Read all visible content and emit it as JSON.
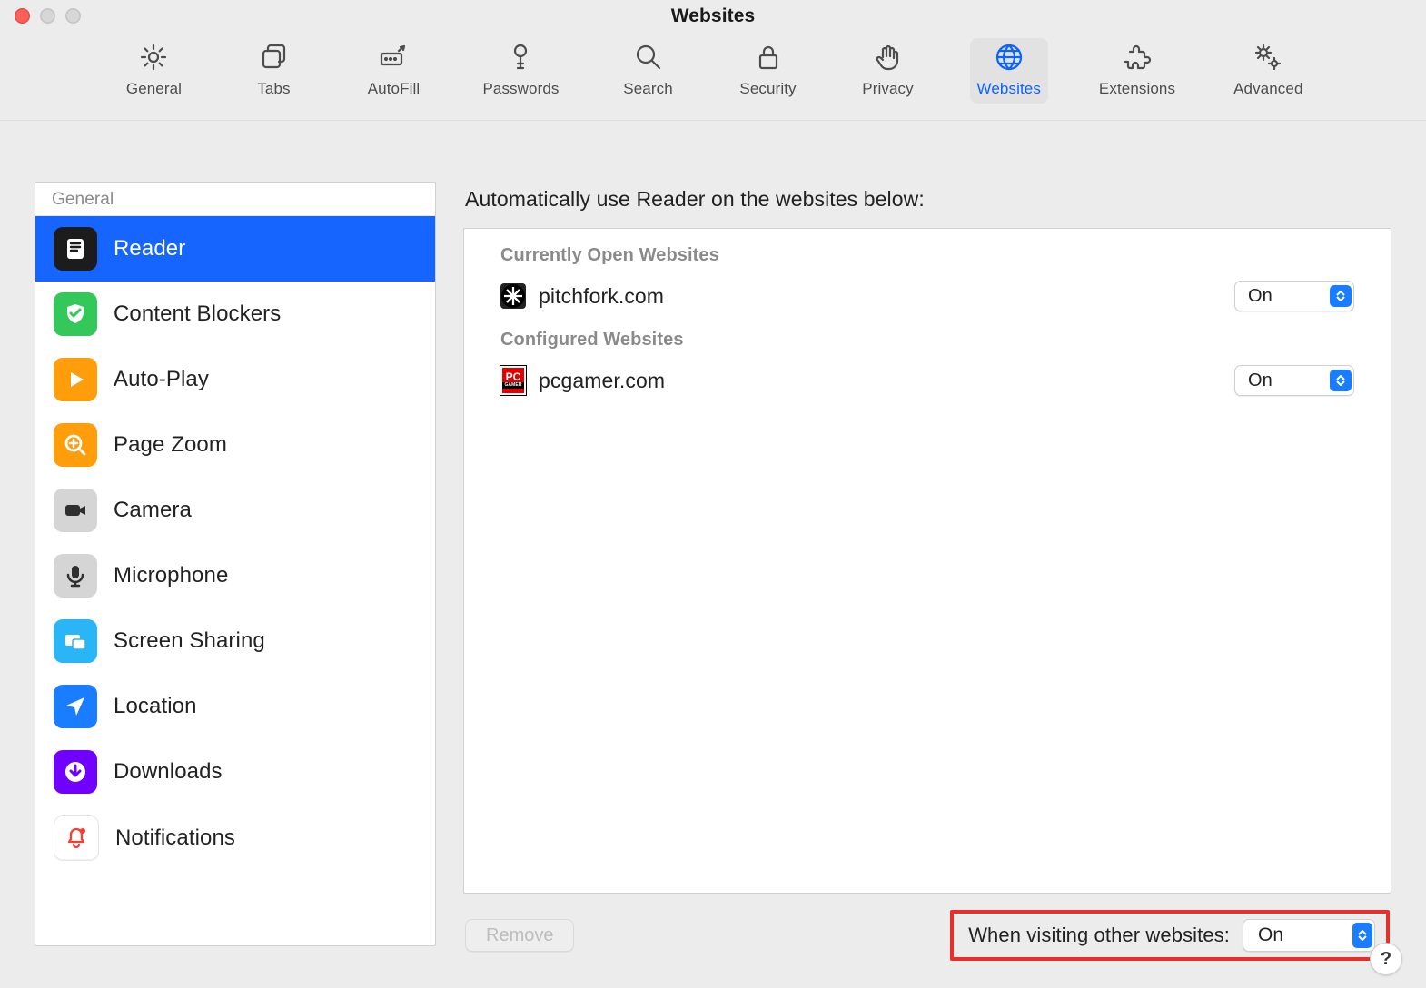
{
  "window": {
    "title": "Websites"
  },
  "traffic": {
    "close": "close",
    "min": "minimize",
    "max": "zoom"
  },
  "toolbar": {
    "items": [
      {
        "id": "general",
        "label": "General",
        "icon": "gear-icon"
      },
      {
        "id": "tabs",
        "label": "Tabs",
        "icon": "tabs-icon"
      },
      {
        "id": "autofill",
        "label": "AutoFill",
        "icon": "autofill-icon"
      },
      {
        "id": "passwords",
        "label": "Passwords",
        "icon": "key-icon"
      },
      {
        "id": "search",
        "label": "Search",
        "icon": "magnify-icon"
      },
      {
        "id": "security",
        "label": "Security",
        "icon": "lock-icon"
      },
      {
        "id": "privacy",
        "label": "Privacy",
        "icon": "hand-icon"
      },
      {
        "id": "websites",
        "label": "Websites",
        "icon": "globe-icon"
      },
      {
        "id": "extensions",
        "label": "Extensions",
        "icon": "puzzle-icon"
      },
      {
        "id": "advanced",
        "label": "Advanced",
        "icon": "gears-icon"
      }
    ],
    "active": "websites"
  },
  "sidebar": {
    "header": "General",
    "items": [
      {
        "id": "reader",
        "label": "Reader",
        "icon": "reader-icon",
        "selected": true
      },
      {
        "id": "content_blockers",
        "label": "Content Blockers",
        "icon": "shield-check-icon"
      },
      {
        "id": "auto_play",
        "label": "Auto-Play",
        "icon": "play-icon"
      },
      {
        "id": "page_zoom",
        "label": "Page Zoom",
        "icon": "zoom-icon"
      },
      {
        "id": "camera",
        "label": "Camera",
        "icon": "camera-icon"
      },
      {
        "id": "microphone",
        "label": "Microphone",
        "icon": "microphone-icon"
      },
      {
        "id": "screen_sharing",
        "label": "Screen Sharing",
        "icon": "screens-icon"
      },
      {
        "id": "location",
        "label": "Location",
        "icon": "location-icon"
      },
      {
        "id": "downloads",
        "label": "Downloads",
        "icon": "download-icon"
      },
      {
        "id": "notifications",
        "label": "Notifications",
        "icon": "bell-icon"
      }
    ]
  },
  "main": {
    "heading": "Automatically use Reader on the websites below:",
    "sections": {
      "open": "Currently Open Websites",
      "configured": "Configured Websites"
    },
    "rows": {
      "open": [
        {
          "site": "pitchfork.com",
          "value": "On",
          "favicon": "pitchfork"
        }
      ],
      "configured": [
        {
          "site": "pcgamer.com",
          "value": "On",
          "favicon": "pcgamer"
        }
      ]
    },
    "remove_label": "Remove",
    "other": {
      "label": "When visiting other websites:",
      "value": "On"
    }
  },
  "help": {
    "label": "?"
  }
}
